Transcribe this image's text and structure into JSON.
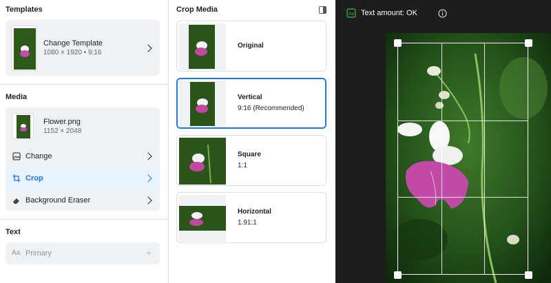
{
  "templates": {
    "title": "Templates",
    "name": "Change Template",
    "dims": "1080 × 1920 • 9:16"
  },
  "media": {
    "title": "Media",
    "file_name": "Flower.png",
    "file_dims": "1152 × 2048",
    "actions": [
      {
        "label": "Change",
        "icon": "image-icon",
        "active": false
      },
      {
        "label": "Crop",
        "icon": "crop-icon",
        "active": true
      },
      {
        "label": "Background Eraser",
        "icon": "eraser-icon",
        "active": false
      }
    ]
  },
  "text": {
    "title": "Text",
    "prefix": "Aa",
    "placeholder": "Primary"
  },
  "crop": {
    "title": "Crop Media",
    "options": [
      {
        "title": "Original",
        "sub": "",
        "selected": false
      },
      {
        "title": "Vertical",
        "sub": "9:16 (Recommended)",
        "selected": true
      },
      {
        "title": "Square",
        "sub": "1:1",
        "selected": false
      },
      {
        "title": "Horizontal",
        "sub": "1.91:1",
        "selected": false
      }
    ]
  },
  "preview": {
    "text_amount": "Text amount: OK",
    "accent": "#1877f2",
    "ok_color": "#31a24c"
  }
}
